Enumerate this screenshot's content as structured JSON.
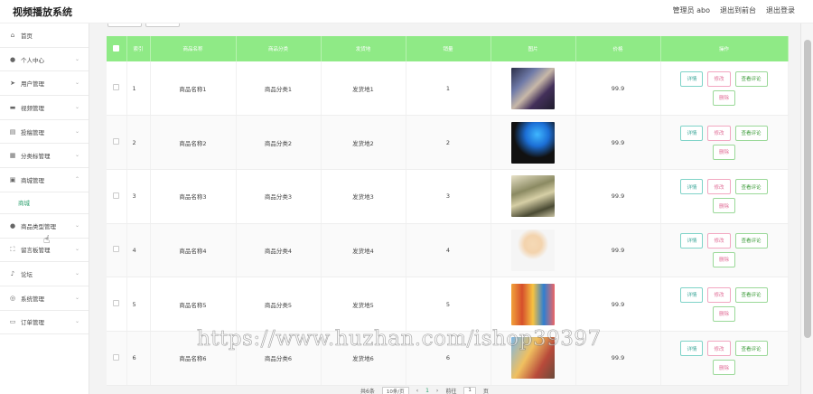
{
  "header": {
    "app_title": "视频播放系统",
    "user_label": "管理员 abo",
    "back_to_front": "退出到前台",
    "logout": "退出登录"
  },
  "sidebar": {
    "items": [
      {
        "label": "首页",
        "icon": "home-icon"
      },
      {
        "label": "个人中心",
        "icon": "user-icon"
      },
      {
        "label": "用户管理",
        "icon": "send-icon"
      },
      {
        "label": "视频管理",
        "icon": "monitor-icon"
      },
      {
        "label": "投稿管理",
        "icon": "printer-icon"
      },
      {
        "label": "分类标管理",
        "icon": "grid-icon"
      },
      {
        "label": "商城管理",
        "icon": "shop-icon"
      }
    ],
    "active_sub": "商城",
    "items_after": [
      {
        "label": "商品类型管理",
        "icon": "user-icon"
      },
      {
        "label": "留言板管理",
        "icon": "fullscreen-icon"
      },
      {
        "label": "论坛",
        "icon": "mic-icon"
      },
      {
        "label": "系统管理",
        "icon": "settings-icon"
      },
      {
        "label": "订单管理",
        "icon": "doc-icon"
      }
    ]
  },
  "table": {
    "headers": [
      "索引",
      "商品名称",
      "商品分类",
      "发货地",
      "销量",
      "图片",
      "价格",
      "操作"
    ],
    "rows": [
      {
        "index": "1",
        "name": "商品名称1",
        "category": "商品分类1",
        "origin": "发货地1",
        "sales": "1",
        "price": "99.9"
      },
      {
        "index": "2",
        "name": "商品名称2",
        "category": "商品分类2",
        "origin": "发货地2",
        "sales": "2",
        "price": "99.9"
      },
      {
        "index": "3",
        "name": "商品名称3",
        "category": "商品分类3",
        "origin": "发货地3",
        "sales": "3",
        "price": "99.9"
      },
      {
        "index": "4",
        "name": "商品名称4",
        "category": "商品分类4",
        "origin": "发货地4",
        "sales": "4",
        "price": "99.9"
      },
      {
        "index": "5",
        "name": "商品名称5",
        "category": "商品分类5",
        "origin": "发货地5",
        "sales": "5",
        "price": "99.9"
      },
      {
        "index": "6",
        "name": "商品名称6",
        "category": "商品分类6",
        "origin": "发货地6",
        "sales": "6",
        "price": "99.9"
      }
    ],
    "actions": {
      "detail": "详情",
      "edit": "修改",
      "review": "查看评论",
      "delete": "删除"
    }
  },
  "pager": {
    "total": "共6条",
    "page_size": "10条/页",
    "current": "1",
    "goto_label": "前往",
    "goto_value": "1",
    "page_suffix": "页"
  },
  "watermark": "https://www.huzhan.com/ishop39397",
  "colors": {
    "header_green": "#8fea86",
    "accent": "#2ca06e"
  }
}
